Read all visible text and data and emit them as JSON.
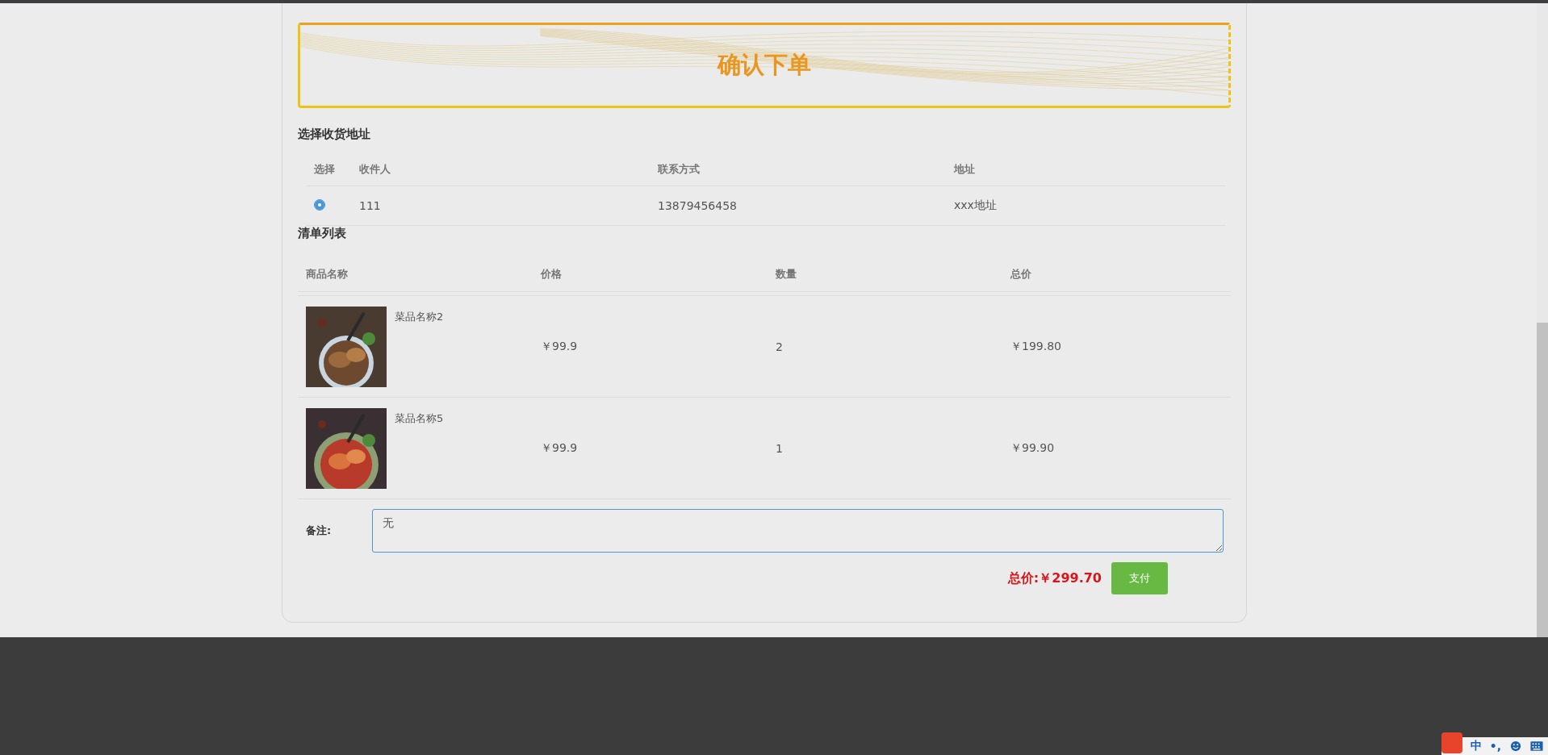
{
  "banner": {
    "title": "确认下单"
  },
  "address_section": {
    "title": "选择收货地址",
    "columns": [
      "选择",
      "收件人",
      "联系方式",
      "地址"
    ],
    "rows": [
      {
        "selected": true,
        "recipient": "111",
        "phone": "13879456458",
        "address": "xxx地址"
      }
    ]
  },
  "list_section": {
    "title": "清单列表",
    "columns": [
      "商品名称",
      "价格",
      "数量",
      "总价"
    ],
    "rows": [
      {
        "name": "菜品名称2",
        "price": "￥99.9",
        "quantity": "2",
        "total": "￥199.80",
        "kind": "picture"
      },
      {
        "name": "菜品名称5",
        "price": "￥99.9",
        "quantity": "1",
        "total": "￥99.90",
        "kind": "picture"
      }
    ]
  },
  "remark": {
    "label": "备注:",
    "value": "无"
  },
  "total": {
    "label": "总价:",
    "value": "￥299.70"
  },
  "pay_button": "支付",
  "ime_toolbar": {
    "language": "中",
    "punctuation": "•,"
  }
}
